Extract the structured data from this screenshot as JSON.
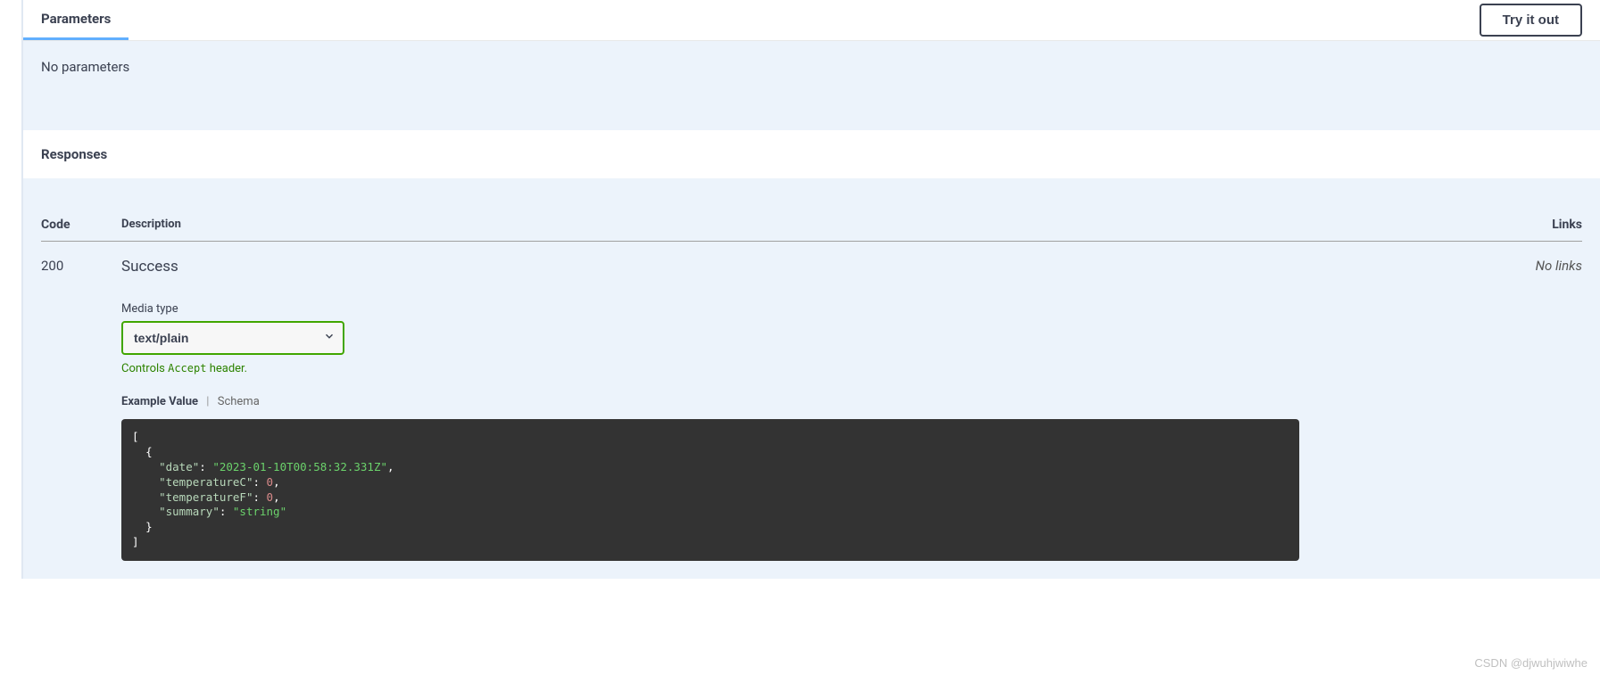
{
  "tabs": {
    "parameters": "Parameters"
  },
  "try_button": "Try it out",
  "no_params": "No parameters",
  "responses_header": "Responses",
  "table": {
    "code": "Code",
    "description": "Description",
    "links": "Links"
  },
  "response": {
    "code": "200",
    "success": "Success",
    "no_links": "No links",
    "media_label": "Media type",
    "media_value": "text/plain",
    "controls_pre": "Controls ",
    "controls_code": "Accept",
    "controls_post": " header.",
    "example_value": "Example Value",
    "schema": "Schema",
    "json": {
      "date_key": "\"date\"",
      "date_val": "\"2023-01-10T00:58:32.331Z\"",
      "tempc_key": "\"temperatureC\"",
      "tempc_val": "0",
      "tempf_key": "\"temperatureF\"",
      "tempf_val": "0",
      "summary_key": "\"summary\"",
      "summary_val": "\"string\""
    }
  },
  "watermark": "CSDN @djwuhjwiwhe"
}
